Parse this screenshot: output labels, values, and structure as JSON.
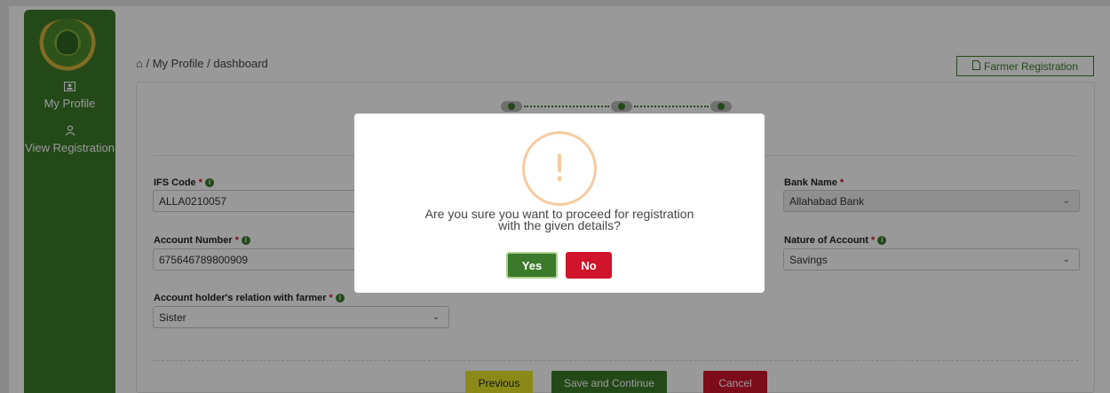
{
  "sidebar": {
    "items": [
      {
        "label": "My Profile",
        "icon": "id-card-icon"
      },
      {
        "label": "View Registration",
        "icon": "user-icon"
      }
    ]
  },
  "breadcrumb": {
    "home_icon": "home-icon",
    "text": "/ My Profile / dashboard"
  },
  "header": {
    "farmer_registration_label": "Farmer Registration",
    "icon": "document-icon"
  },
  "form": {
    "ifs_code": {
      "label": "IFS Code",
      "value": "ALLA0210057"
    },
    "bank_name": {
      "label": "Bank Name",
      "value": "Allahabad Bank"
    },
    "account_number": {
      "label": "Account Number",
      "value": "675646789800909"
    },
    "nature_of_account": {
      "label": "Nature of Account",
      "value": "Savings"
    },
    "relation": {
      "label": "Account holder's relation with farmer",
      "value": "Sister"
    },
    "required_mark": "*"
  },
  "buttons": {
    "previous": "Previous",
    "save_continue": "Save and Continue",
    "cancel": "Cancel"
  },
  "modal": {
    "icon": "warning-icon",
    "glyph": "!",
    "message_line1": "Are you sure you want to proceed for registration",
    "message_line2": "with the given details?",
    "yes": "Yes",
    "no": "No"
  },
  "colors": {
    "primary_green": "#3b7a2a",
    "danger_red": "#d0142c",
    "warning_orange": "#f5cba1",
    "previous_yellow": "#e8e62b"
  }
}
